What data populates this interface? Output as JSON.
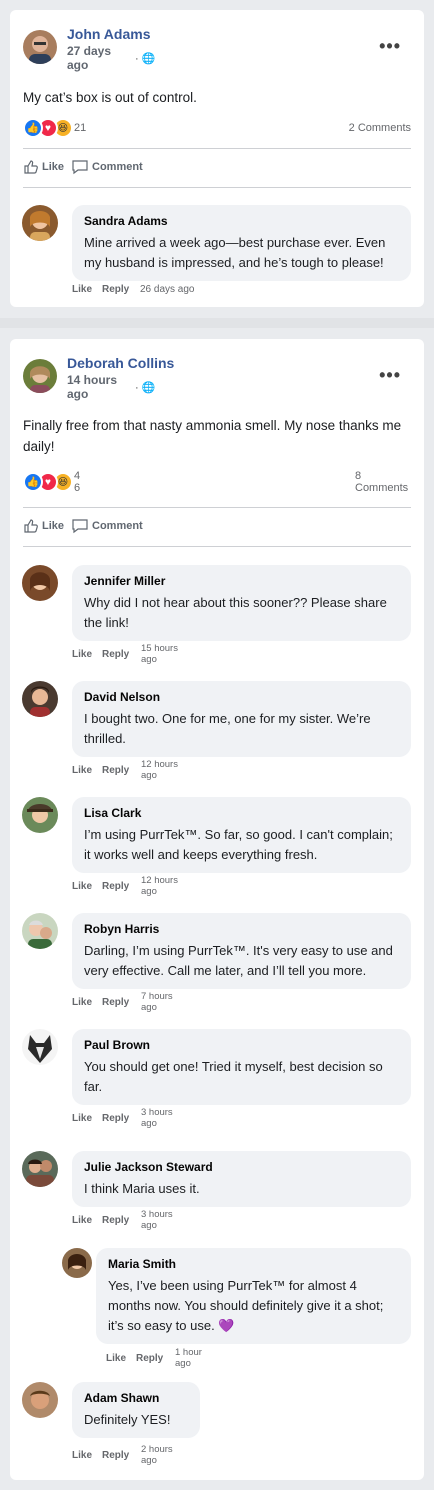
{
  "post1": {
    "author": "John Adams",
    "time": "27 days ago",
    "text": "My cat’s box is out of control.",
    "reaction_count": "21",
    "comment_count": "2 Comments",
    "like_label": "Like",
    "comment_label": "Comment",
    "comments": [
      {
        "name": "Sandra Adams",
        "text": "Mine arrived a week ago—best purchase ever. Even my husband is impressed, and he’s tough to please!",
        "like": "Like",
        "reply": "Reply",
        "time": "26 days ago"
      }
    ]
  },
  "post2": {
    "author": "Deborah Collins",
    "time": "14 hours ago",
    "text": "Finally free from that nasty ammonia smell. My nose thanks me daily!",
    "reaction_count": "46",
    "comment_count": "8 Comments",
    "like_label": "Like",
    "comment_label": "Comment",
    "comments": [
      {
        "name": "Jennifer Miller",
        "text": "Why did I not hear about this sooner?? Please share the link!",
        "like": "Like",
        "reply": "Reply",
        "time": "15 hours ago"
      },
      {
        "name": "David Nelson",
        "text": "I bought two. One for me, one for my sister. We’re thrilled.",
        "like": "Like",
        "reply": "Reply",
        "time": "12 hours ago"
      },
      {
        "name": "Lisa Clark",
        "text": "I’m using PurrTek™. So far, so good. I can't complain; it works well and keeps everything fresh.",
        "like": "Like",
        "reply": "Reply",
        "time": "12 hours ago"
      },
      {
        "name": "Robyn Harris",
        "text": "Darling, I’m using PurrTek™. It's very easy to use and very effective. Call me later, and I’ll tell you more.",
        "like": "Like",
        "reply": "Reply",
        "time": "7 hours ago"
      },
      {
        "name": "Paul Brown",
        "text": "You should get one! Tried it myself, best decision so far.",
        "like": "Like",
        "reply": "Reply",
        "time": "3 hours ago"
      },
      {
        "name": "Julie Jackson Steward",
        "text": "I think Maria uses it.",
        "like": "Like",
        "reply": "Reply",
        "time": "3 hours ago"
      },
      {
        "name": "Maria Smith",
        "text": "Yes, I’ve been using PurrTek™ for almost 4 months now. You should definitely give it a shot; it’s so easy to use. 💜",
        "like": "Like",
        "reply": "Reply",
        "time": "1 hour ago"
      },
      {
        "name": "Adam Shawn",
        "text": "Definitely YES!",
        "like": "Like",
        "reply": "Reply",
        "time": "2 hours ago"
      }
    ]
  },
  "colors": {
    "link": "#385898",
    "like": "#1877f2",
    "love": "#f02849",
    "haha": "#f7b125",
    "bubble": "#f0f2f5"
  }
}
